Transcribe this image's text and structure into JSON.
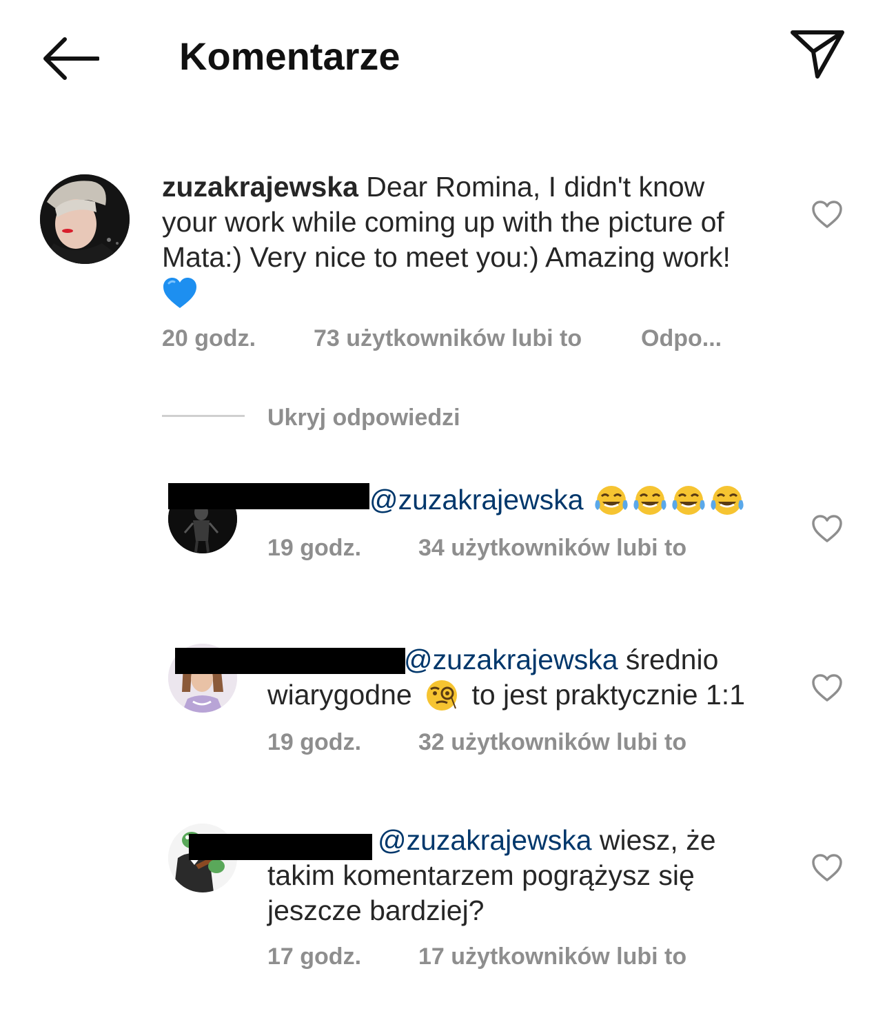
{
  "header": {
    "title": "Komentarze"
  },
  "main_comment": {
    "username": "zuzakrajewska",
    "text_line1": " Dear Romina, I didn't know",
    "text_line2": "your work while coming up with the picture of",
    "text_line3": "Mata:) Very nice to meet you:) Amazing work!",
    "emoji": "blue-heart",
    "time": "20 godz.",
    "likes": "73 użytkowników lubi to",
    "reply": "Odpo..."
  },
  "hide_replies_label": "Ukryj odpowiedzi",
  "replies": [
    {
      "mention": "@zuzakrajewska",
      "emoji_count": 4,
      "emoji": "tears-of-joy",
      "time": "19 godz.",
      "likes": "34 użytkowników lubi to"
    },
    {
      "mention": "@zuzakrajewska",
      "text_after_mention": " średnio",
      "text_line2_a": "wiarygodne ",
      "emoji": "face-with-monocle",
      "text_line2_b": " to jest praktycznie 1:1",
      "time": "19 godz.",
      "likes": "32 użytkowników lubi to"
    },
    {
      "mention": "@zuzakrajewska",
      "text_after_mention": " wiesz, że",
      "text_line2": "takim komentarzem pogrążysz się",
      "text_line3": "jeszcze bardziej?",
      "time": "17 godz.",
      "likes": "17 użytkowników lubi to"
    }
  ],
  "colors": {
    "text": "#262626",
    "meta": "#8e8e8e",
    "mention": "#00376b",
    "heart_outline": "#8e8e8e",
    "blue_heart": "#1d8ff0"
  }
}
